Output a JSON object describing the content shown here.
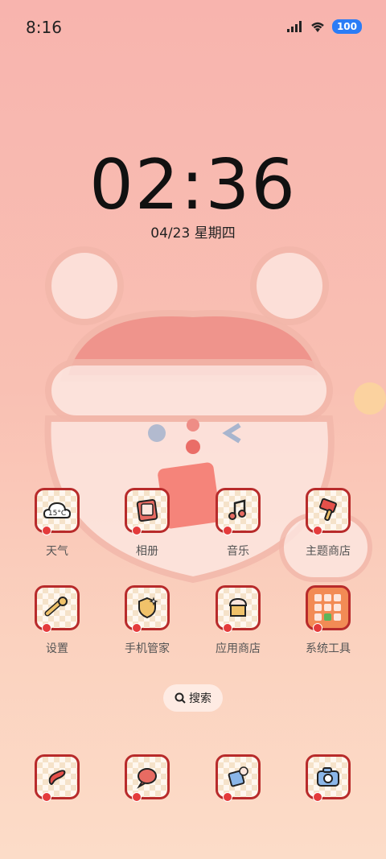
{
  "status": {
    "time": "8:16",
    "battery": "100"
  },
  "lock": {
    "clock": "02:36",
    "date": "04/23 星期四"
  },
  "apps_row1": [
    {
      "label": "天气",
      "icon": "weather-icon",
      "badge": "15°C"
    },
    {
      "label": "相册",
      "icon": "gallery-icon"
    },
    {
      "label": "音乐",
      "icon": "music-icon"
    },
    {
      "label": "主题商店",
      "icon": "theme-store-icon"
    }
  ],
  "apps_row2": [
    {
      "label": "设置",
      "icon": "settings-icon"
    },
    {
      "label": "手机管家",
      "icon": "phone-manager-icon"
    },
    {
      "label": "应用商店",
      "icon": "app-store-icon"
    },
    {
      "label": "系统工具",
      "icon": "system-tools-folder-icon"
    }
  ],
  "search": {
    "label": "搜索"
  },
  "dock": [
    {
      "icon": "phone-icon"
    },
    {
      "icon": "messages-icon"
    },
    {
      "icon": "browser-icon"
    },
    {
      "icon": "camera-icon"
    }
  ]
}
